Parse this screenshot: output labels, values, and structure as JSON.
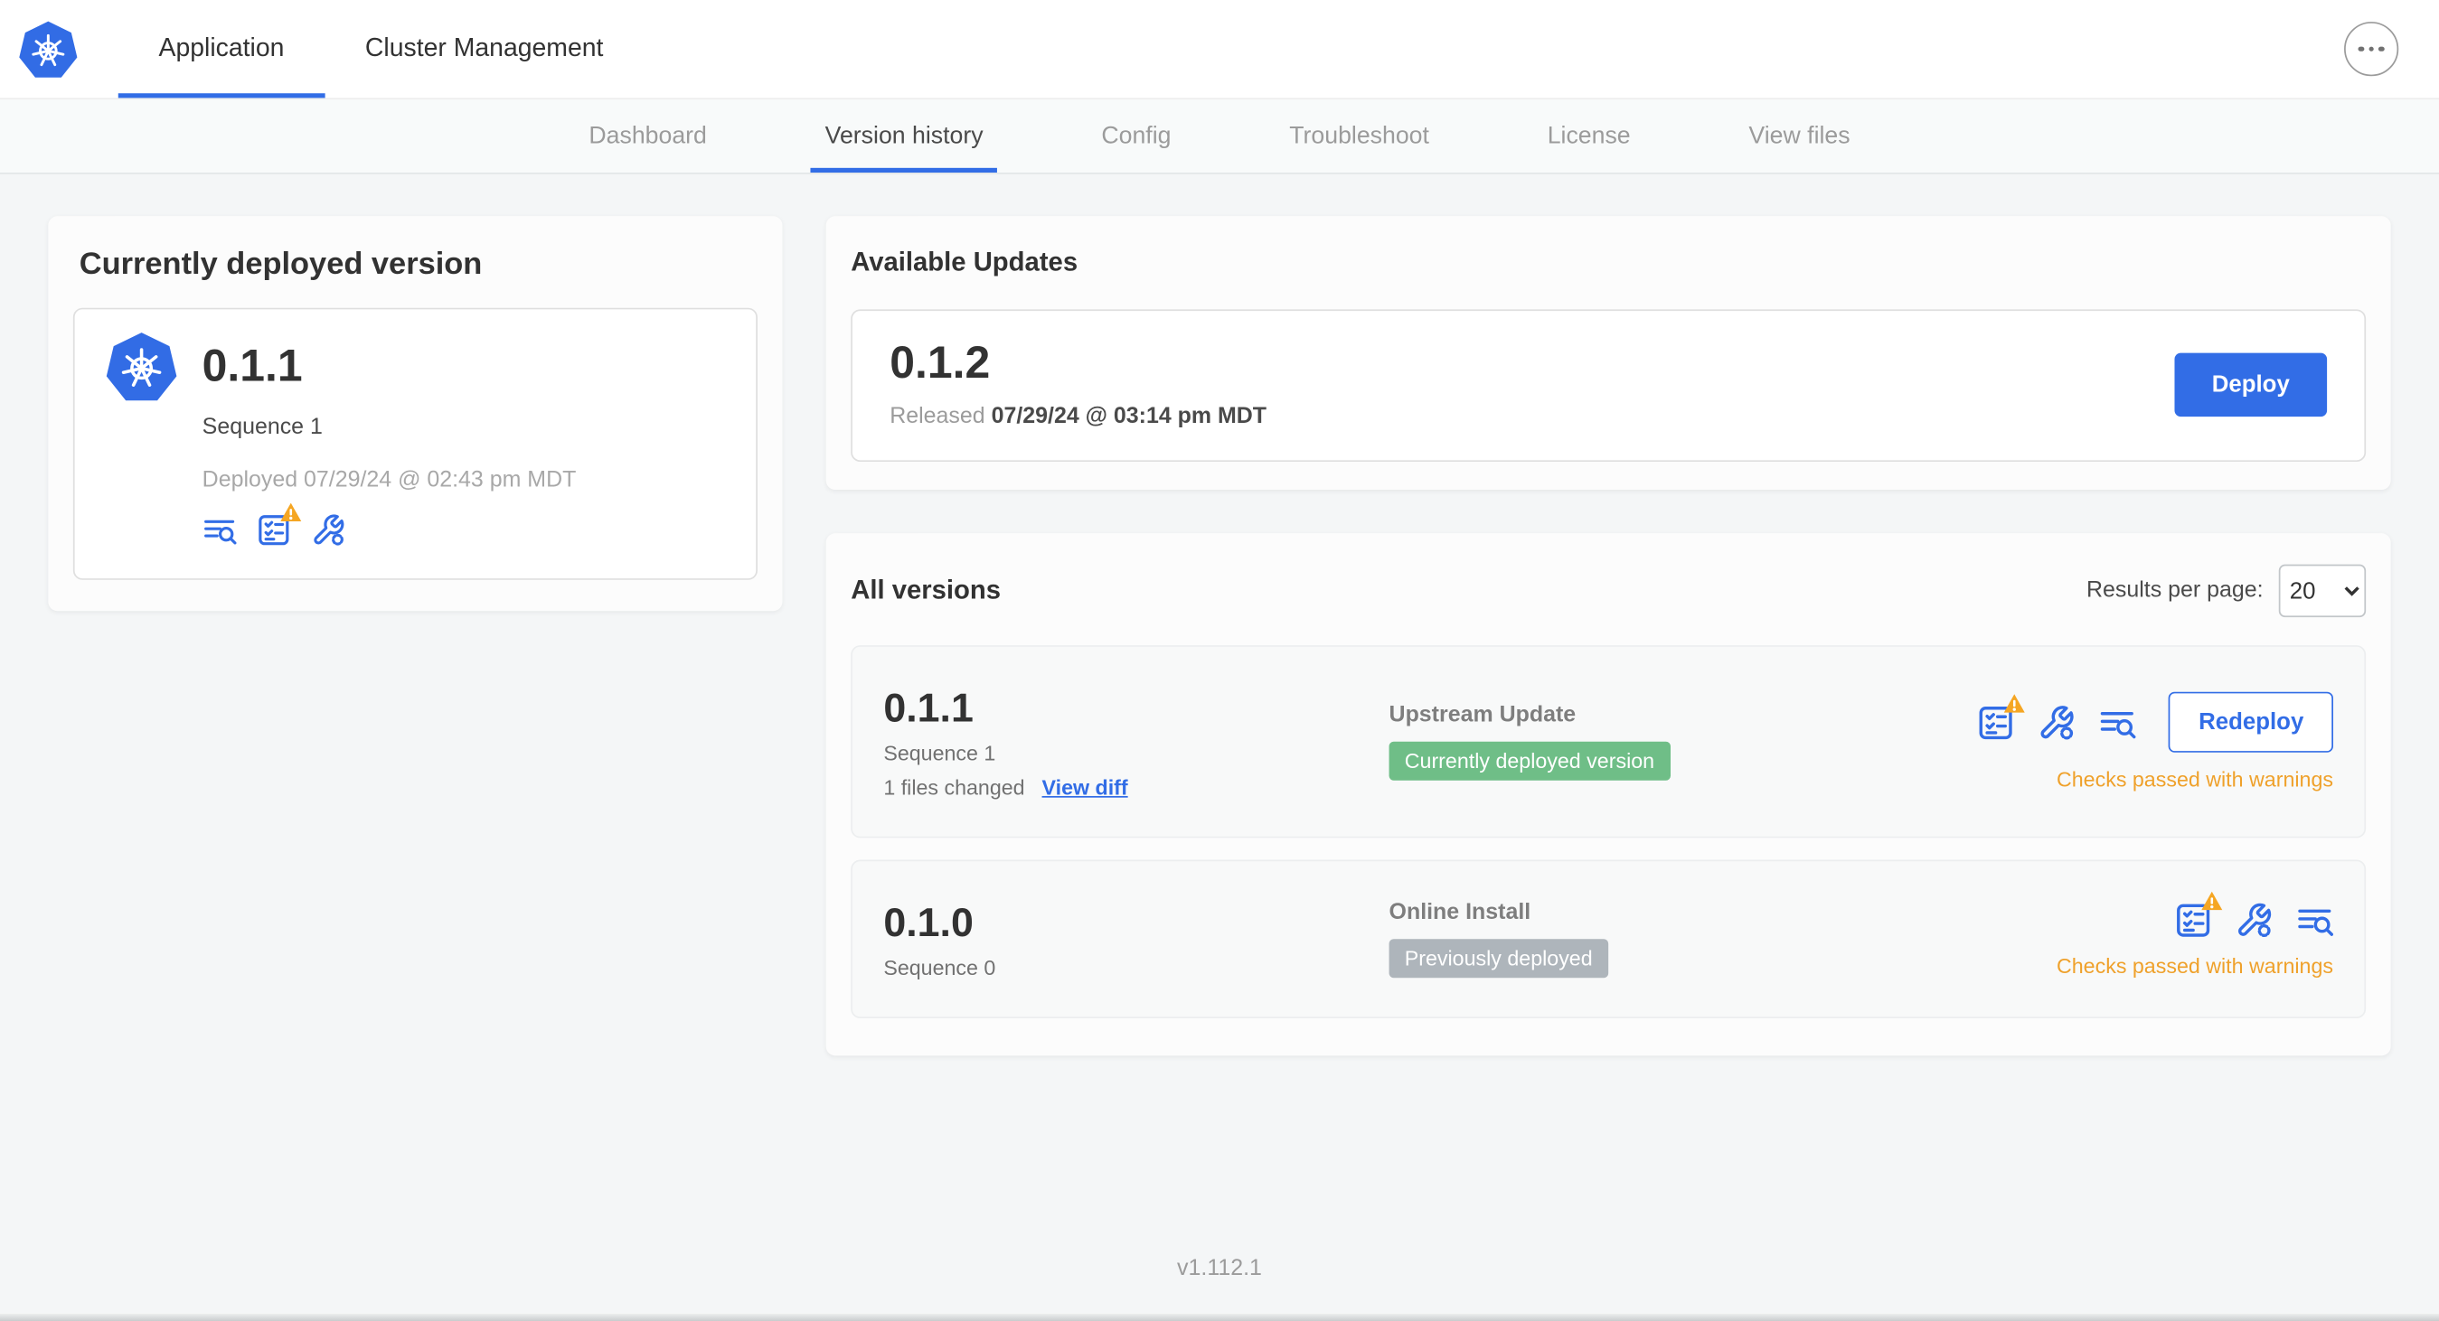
{
  "colors": {
    "primary_blue": "#326DE6",
    "kubernetes_blue": "#326CE5",
    "success_badge_green": "#6FBE87",
    "muted_badge_gray": "#AEB5BB",
    "warning_text_orange": "#EFA12B",
    "warning_triangle_yellow": "#F5A623"
  },
  "icons": {
    "logo": "kubernetes-logo",
    "more_options": "more-options-icon",
    "release_notes": "release-notes-logs-icon",
    "preflight": "preflight-checklist-icon",
    "preflight_warning": "warning-triangle-icon",
    "config": "config-wrench-icon"
  },
  "topnav": {
    "tabs": [
      "Application",
      "Cluster Management"
    ]
  },
  "subnav": {
    "tabs": [
      "Dashboard",
      "Version history",
      "Config",
      "Troubleshoot",
      "License",
      "View files"
    ],
    "active_tab": "Version history"
  },
  "currently_deployed": {
    "title": "Currently deployed version",
    "version": "0.1.1",
    "sequence": "Sequence 1",
    "deployed": "Deployed 07/29/24 @ 02:43 pm MDT"
  },
  "available_updates": {
    "title": "Available Updates",
    "version": "0.1.2",
    "released_label": "Released",
    "released_date": "07/29/24 @ 03:14 pm MDT",
    "deploy_button": "Deploy"
  },
  "all_versions": {
    "title": "All versions",
    "results_per_page_label": "Results per page:",
    "results_per_page": "20",
    "rows": [
      {
        "version": "0.1.1",
        "sequence": "Sequence 1",
        "files_changed": "1 files changed",
        "view_diff_link": "View diff",
        "source": "Upstream Update",
        "status_badge": "Currently deployed version",
        "action_button": "Redeploy",
        "checks_status": "Checks passed with warnings"
      },
      {
        "version": "0.1.0",
        "sequence": "Sequence 0",
        "source": "Online Install",
        "status_badge": "Previously deployed",
        "checks_status": "Checks passed with warnings"
      }
    ]
  },
  "footer": {
    "app_version": "v1.112.1"
  }
}
